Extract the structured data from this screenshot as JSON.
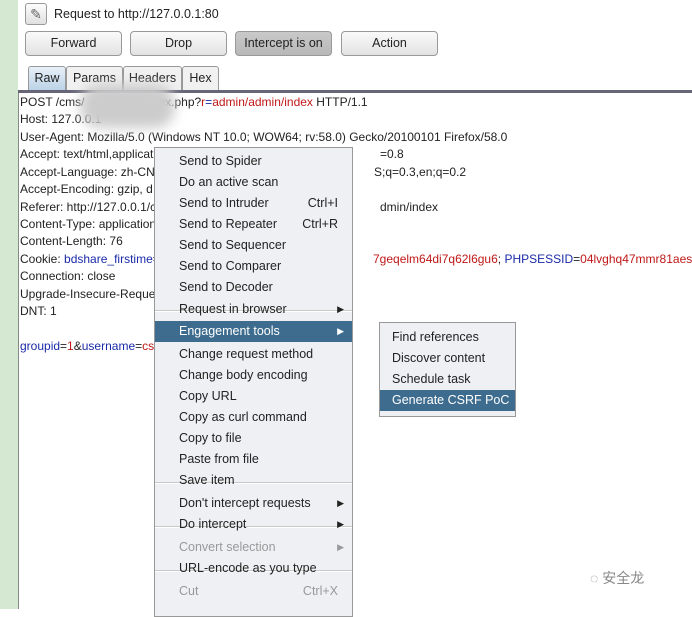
{
  "header": {
    "title": "Request to http://127.0.0.1:80",
    "icon": "pencil-icon"
  },
  "buttons": {
    "forward": "Forward",
    "drop": "Drop",
    "intercept": "Intercept is on",
    "action": "Action"
  },
  "tabs": [
    "Raw",
    "Params",
    "Headers",
    "Hex"
  ],
  "request": {
    "line1": {
      "a": "POST /cms/",
      "b": "index.php?",
      "c": "r",
      "d": "=",
      "e": "admin/admin/index",
      "f": " HTTP/1.1"
    },
    "host": "Host: 127.0.0.1",
    "ua": "User-Agent: Mozilla/5.0 (Windows NT 10.0; WOW64; rv:58.0) Gecko/20100101 Firefox/58.0",
    "accept_l": "Accept: text/html,applicat",
    "accept_r": "=0.8",
    "lang_l": "Accept-Language: zh-CN",
    "lang_r": "S;q=0.3,en;q=0.2",
    "enc": "Accept-Encoding: gzip, d",
    "ref_l": "Referer: http://127.0.0.1/c",
    "ref_r": "dmin/index",
    "ctype": "Content-Type: application",
    "clen": "Content-Length: 76",
    "cookie_l": "Cookie: ",
    "cookie_k": "bdshare_firstime",
    "cookie_eq": "=",
    "cookie_r1": "7geqelm64di7q62l6gu6",
    "cookie_r2": "; ",
    "cookie_k2": "PHPSESSID",
    "cookie_eq2": "=",
    "cookie_v2": "04lvghq47mmr81aesv",
    "conn": "Connection: close",
    "upg": "Upgrade-Insecure-Reques",
    "dnt": "DNT: 1",
    "body": {
      "k1": "groupid",
      "eq1": "=",
      "v1": "1",
      "amp": "&",
      "k2": "username",
      "eq2": "=",
      "v2": "cs"
    }
  },
  "menu": [
    {
      "label": "Send to Spider"
    },
    {
      "label": "Do an active scan"
    },
    {
      "label": "Send to Intruder",
      "shortcut": "Ctrl+I"
    },
    {
      "label": "Send to Repeater",
      "shortcut": "Ctrl+R"
    },
    {
      "label": "Send to Sequencer"
    },
    {
      "label": "Send to Comparer"
    },
    {
      "label": "Send to Decoder"
    },
    {
      "label": "Request in browser",
      "submenu": true
    },
    {
      "label": "Engagement tools",
      "submenu": true,
      "highlighted": true
    },
    {
      "label": "Change request method"
    },
    {
      "label": "Change body encoding"
    },
    {
      "label": "Copy URL"
    },
    {
      "label": "Copy as curl command"
    },
    {
      "label": "Copy to file"
    },
    {
      "label": "Paste from file"
    },
    {
      "label": "Save item"
    },
    {
      "label": "Don't intercept requests",
      "submenu": true
    },
    {
      "label": "Do intercept",
      "submenu": true
    },
    {
      "label": "Convert selection",
      "submenu": true,
      "disabled": true
    },
    {
      "label": "URL-encode as you type"
    },
    {
      "label": "Cut",
      "shortcut": "Ctrl+X",
      "disabled": true
    }
  ],
  "submenu": [
    {
      "label": "Find references"
    },
    {
      "label": "Discover content"
    },
    {
      "label": "Schedule task"
    },
    {
      "label": "Generate CSRF PoC",
      "highlighted": true
    }
  ],
  "watermark": "安全龙",
  "colors": {
    "highlight": "#3e6c8e",
    "param_red": "#c01818",
    "param_blue": "#1a2aa8"
  }
}
